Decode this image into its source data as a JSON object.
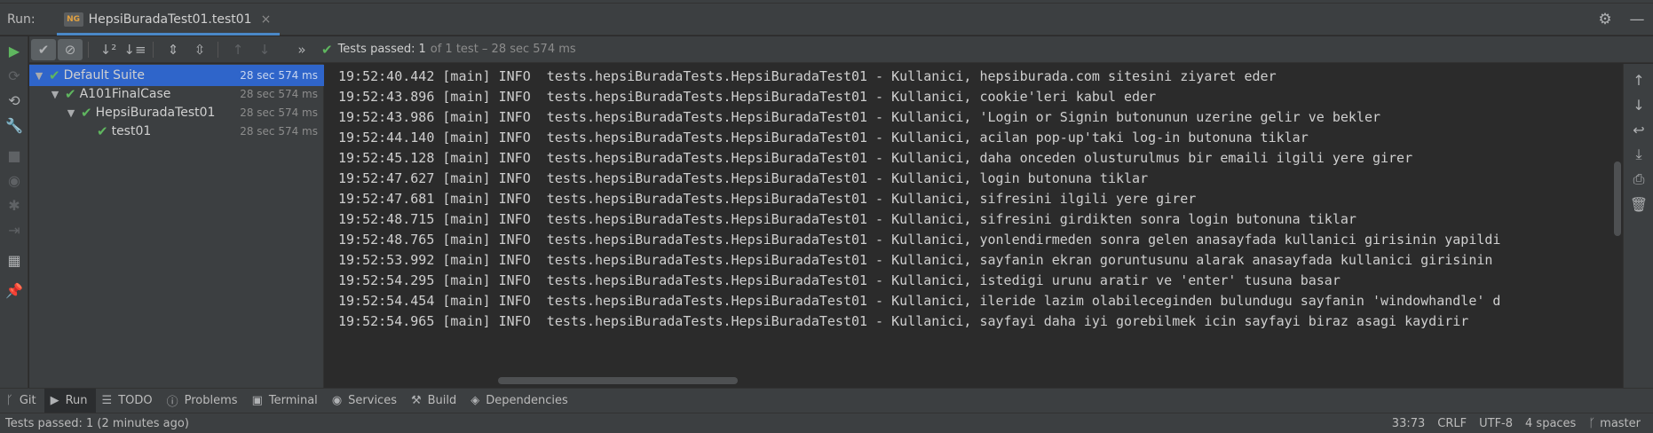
{
  "run_header": {
    "label": "Run:",
    "tab_title": "HepsiBuradaTest01.test01",
    "tab_icon_text": "NG",
    "close_glyph": "×",
    "settings_icon": "gear-icon",
    "minimize_icon": "minimize-icon"
  },
  "toolbar": {
    "status_label": "Tests passed:",
    "status_count": "1",
    "status_detail": "of 1 test – 28 sec 574 ms",
    "buttons": [
      "show-passed-icon",
      "show-ignored-icon",
      "sort-alphabetically-icon",
      "sort-by-duration-icon",
      "expand-all-icon",
      "collapse-all-icon",
      "previous-failed-icon",
      "next-failed-icon",
      "more-icon"
    ]
  },
  "tree": [
    {
      "label": "Default Suite",
      "time": "28 sec 574 ms",
      "selected": true
    },
    {
      "label": "A101FinalCase",
      "time": "28 sec 574 ms",
      "selected": false
    },
    {
      "label": "HepsiBuradaTest01",
      "time": "28 sec 574 ms",
      "selected": false
    },
    {
      "label": "test01",
      "time": "28 sec 574 ms",
      "selected": false
    }
  ],
  "console": {
    "lines": [
      "19:52:40.442 [main] INFO  tests.hepsiBuradaTests.HepsiBuradaTest01 - Kullanici, hepsiburada.com sitesini ziyaret eder",
      "19:52:43.896 [main] INFO  tests.hepsiBuradaTests.HepsiBuradaTest01 - Kullanici, cookie'leri kabul eder",
      "19:52:43.986 [main] INFO  tests.hepsiBuradaTests.HepsiBuradaTest01 - Kullanici, 'Login or Signin butonunun uzerine gelir ve bekler",
      "19:52:44.140 [main] INFO  tests.hepsiBuradaTests.HepsiBuradaTest01 - Kullanici, acilan pop-up'taki log-in butonuna tiklar",
      "19:52:45.128 [main] INFO  tests.hepsiBuradaTests.HepsiBuradaTest01 - Kullanici, daha onceden olusturulmus bir emaili ilgili yere girer",
      "19:52:47.627 [main] INFO  tests.hepsiBuradaTests.HepsiBuradaTest01 - Kullanici, login butonuna tiklar",
      "19:52:47.681 [main] INFO  tests.hepsiBuradaTests.HepsiBuradaTest01 - Kullanici, sifresini ilgili yere girer",
      "19:52:48.715 [main] INFO  tests.hepsiBuradaTests.HepsiBuradaTest01 - Kullanici, sifresini girdikten sonra login butonuna tiklar",
      "19:52:48.765 [main] INFO  tests.hepsiBuradaTests.HepsiBuradaTest01 - Kullanici, yonlendirmeden sonra gelen anasayfada kullanici girisinin yapildi",
      "19:52:53.992 [main] INFO  tests.hepsiBuradaTests.HepsiBuradaTest01 - Kullanici, sayfanin ekran goruntusunu alarak anasayfada kullanici girisinin",
      "19:52:54.295 [main] INFO  tests.hepsiBuradaTests.HepsiBuradaTest01 - Kullanici, istedigi urunu aratir ve 'enter' tusuna basar",
      "19:52:54.454 [main] INFO  tests.hepsiBuradaTests.HepsiBuradaTest01 - Kullanici, ileride lazim olabileceginden bulundugu sayfanin 'windowhandle' d",
      "19:52:54.965 [main] INFO  tests.hepsiBuradaTests.HepsiBuradaTest01 - Kullanici, sayfayi daha iyi gorebilmek icin sayfayi biraz asagi kaydirir"
    ]
  },
  "right_strip": [
    "up-arrow-icon",
    "down-arrow-icon",
    "soft-wrap-icon",
    "scroll-to-end-icon",
    "print-icon",
    "trash-icon"
  ],
  "left_strip": [
    "run-icon",
    "rerun-failed-icon",
    "toggle-auto-test-icon",
    "settings-wrench-icon",
    "stop-icon",
    "screenshot-icon",
    "debug-icon",
    "import-icon",
    "layout-icon",
    "pin-icon"
  ],
  "bottom_tabs": [
    {
      "label": "Git",
      "icon": "git-branch-icon",
      "active": false
    },
    {
      "label": "Run",
      "icon": "run-triangle-icon",
      "active": true
    },
    {
      "label": "TODO",
      "icon": "todo-list-icon",
      "active": false
    },
    {
      "label": "Problems",
      "icon": "problems-icon",
      "active": false
    },
    {
      "label": "Terminal",
      "icon": "terminal-icon",
      "active": false
    },
    {
      "label": "Services",
      "icon": "services-icon",
      "active": false
    },
    {
      "label": "Build",
      "icon": "build-hammer-icon",
      "active": false
    },
    {
      "label": "Dependencies",
      "icon": "dependencies-icon",
      "active": false
    }
  ],
  "status_bar": {
    "message": "Tests passed: 1 (2 minutes ago)",
    "position": "33:73",
    "line_ending": "CRLF",
    "encoding": "UTF-8",
    "indent": "4 spaces",
    "branch": "master"
  },
  "colors": {
    "accent_blue": "#4a88c7",
    "selection": "#2f65ca",
    "pass_green": "#5fb65f",
    "panel": "#3c3f41",
    "editor": "#2b2b2b"
  }
}
